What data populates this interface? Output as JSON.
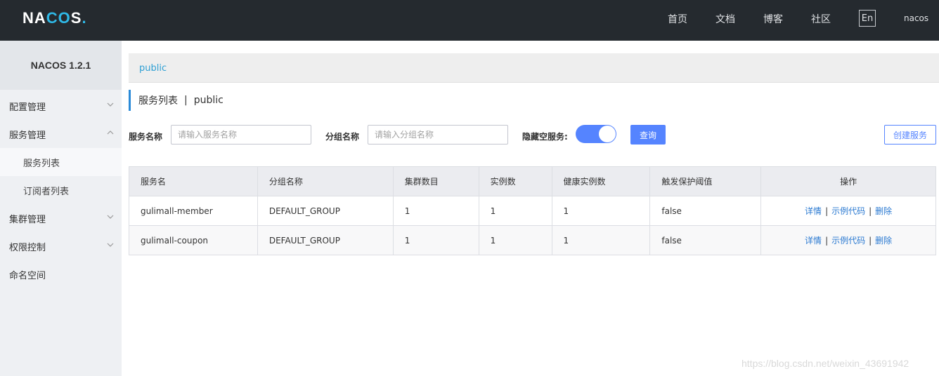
{
  "header": {
    "logo": "NACOS",
    "nav": [
      "首页",
      "文档",
      "博客",
      "社区"
    ],
    "lang": "En",
    "user": "nacos"
  },
  "sidebar": {
    "title": "NACOS 1.2.1",
    "items": [
      {
        "label": "配置管理",
        "expanded": false
      },
      {
        "label": "服务管理",
        "expanded": true
      },
      {
        "label": "服务列表",
        "sub": true,
        "active": true
      },
      {
        "label": "订阅者列表",
        "sub": true
      },
      {
        "label": "集群管理",
        "expanded": false
      },
      {
        "label": "权限控制",
        "expanded": false
      },
      {
        "label": "命名空间"
      }
    ]
  },
  "breadcrumb": {
    "namespace": "public"
  },
  "page": {
    "title": "服务列表",
    "separator": "|",
    "namespace": "public"
  },
  "filters": {
    "service_name_label": "服务名称",
    "service_name_placeholder": "请输入服务名称",
    "group_name_label": "分组名称",
    "group_name_placeholder": "请输入分组名称",
    "hide_empty_label": "隐藏空服务:",
    "hide_empty_on": true,
    "query_label": "查询",
    "create_label": "创建服务"
  },
  "table": {
    "columns": [
      "服务名",
      "分组名称",
      "集群数目",
      "实例数",
      "健康实例数",
      "触发保护阈值",
      "操作"
    ],
    "rows": [
      {
        "name": "gulimall-member",
        "group": "DEFAULT_GROUP",
        "clusters": "1",
        "instances": "1",
        "healthy": "1",
        "protect": "false"
      },
      {
        "name": "gulimall-coupon",
        "group": "DEFAULT_GROUP",
        "clusters": "1",
        "instances": "1",
        "healthy": "1",
        "protect": "false"
      }
    ],
    "ops": {
      "detail": "详情",
      "sample": "示例代码",
      "delete": "删除",
      "sep": "|"
    }
  },
  "watermark": "https://blog.csdn.net/weixin_43691942",
  "colors": {
    "accent": "#5584ff",
    "header_bg": "#252a2f",
    "sidebar_bg": "#eef0f3",
    "link": "#2a79d1"
  }
}
